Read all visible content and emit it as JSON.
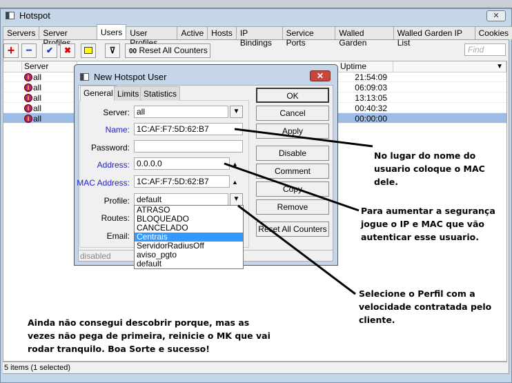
{
  "window": {
    "title": "Hotspot",
    "close": "✕"
  },
  "tabs": [
    "Servers",
    "Server Profiles",
    "Users",
    "User Profiles",
    "Active",
    "Hosts",
    "IP Bindings",
    "Service Ports",
    "Walled Garden",
    "Walled Garden IP List",
    "Cookies"
  ],
  "active_tab": "Users",
  "toolbar": {
    "add": "+",
    "remove": "−",
    "enable": "✔",
    "disable": "✖",
    "comment": "▭",
    "filter": "⊽",
    "reset_icon": "00",
    "reset": "Reset All Counters",
    "find_placeholder": "Find"
  },
  "table": {
    "columns": [
      "Server",
      "Uptime"
    ],
    "rows": [
      {
        "server": "all",
        "uptime": "21:54:09"
      },
      {
        "server": "all",
        "uptime": "06:09:03"
      },
      {
        "server": "all",
        "uptime": "13:13:05"
      },
      {
        "server": "all",
        "uptime": "00:40:32"
      },
      {
        "server": "all",
        "uptime": "00:00:00",
        "selected": true
      }
    ]
  },
  "status": "5 items (1 selected)",
  "dialog": {
    "title": "New Hotspot User",
    "tabs": [
      "General",
      "Limits",
      "Statistics"
    ],
    "fields": {
      "server_label": "Server:",
      "server": "all",
      "name_label": "Name:",
      "name": "1C:AF:F7:5D:62:B7",
      "password_label": "Password:",
      "password": "",
      "address_label": "Address:",
      "address": "0.0.0.0",
      "mac_label": "MAC Address:",
      "mac": "1C:AF:F7:5D:62:B7",
      "profile_label": "Profile:",
      "profile": "default",
      "routes_label": "Routes:",
      "email_label": "Email:"
    },
    "buttons": [
      "OK",
      "Cancel",
      "Apply",
      "Disable",
      "Comment",
      "Copy",
      "Remove",
      "Reset All Counters"
    ],
    "profile_options": [
      "ATRASO",
      "BLOQUEADO",
      "CANCELADO",
      "Centrais",
      "ServidorRadiusOff",
      "aviso_pgto",
      "default"
    ],
    "highlighted_option": "Centrais",
    "status": "disabled"
  },
  "annotations": {
    "name_note": [
      "No lugar do nome do",
      "usuario coloque o MAC",
      "dele."
    ],
    "ip_note": [
      "Para aumentar a segurança",
      "jogue o IP e MAC que vão",
      "autenticar esse usuario."
    ],
    "profile_note": [
      "Selecione o Perfil com a",
      "velocidade contratada pelo",
      "cliente."
    ],
    "footer_note": [
      "Ainda não consegui descobrir porque, mas as",
      "vezes não pega de primeira, reinicie o MK que vai",
      "rodar tranquilo. Boa Sorte e sucesso!"
    ]
  },
  "colors": {
    "selected_row": "#9dbde6",
    "highlight": "#3399ff",
    "blue_label": "#2222cc",
    "close_red": "#c8473c"
  }
}
